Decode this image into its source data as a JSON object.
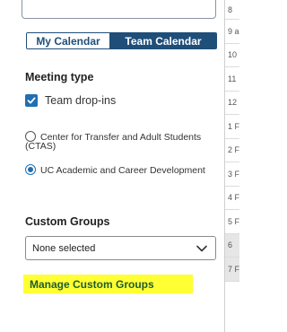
{
  "calendar_toggle": {
    "my_calendar_label": "My Calendar",
    "team_calendar_label": "Team Calendar"
  },
  "meeting_type": {
    "heading": "Meeting type",
    "checkbox_label": "Team drop-ins",
    "options": [
      {
        "label": "Center for Transfer and Adult Students (CTAS)",
        "selected": false
      },
      {
        "label": "UC Academic and Career Development",
        "selected": true
      }
    ]
  },
  "custom_groups": {
    "heading": "Custom Groups",
    "selected_value": "None selected",
    "manage_link_label": "Manage Custom Groups"
  },
  "time_labels": [
    "8",
    "9 a",
    "10",
    "11",
    "12",
    "1 F",
    "2 F",
    "3 F",
    "4 F",
    "5 F",
    "6",
    "7 F"
  ],
  "colors": {
    "accent": "#1f4e79",
    "checkbox": "#1f6fb2",
    "highlight": "#ffff33",
    "link_text": "#1f5c2e"
  }
}
